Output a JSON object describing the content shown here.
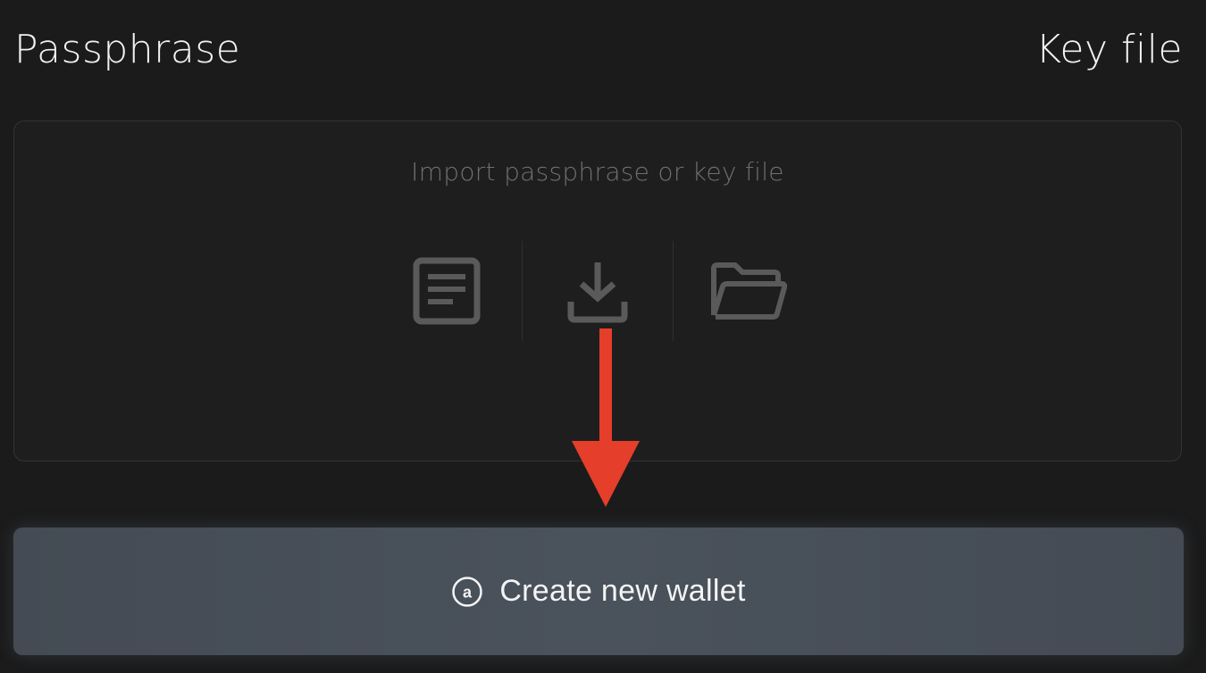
{
  "tabs": {
    "passphrase_label": "Passphrase",
    "keyfile_label": "Key file"
  },
  "dropzone": {
    "title": "Import passphrase or key file",
    "icons": [
      "document-icon",
      "download-icon",
      "folder-icon"
    ]
  },
  "create_button": {
    "label": "Create new wallet",
    "icon": "arweave-logo-icon",
    "icon_letter": "a"
  },
  "colors": {
    "background": "#1b1b1b",
    "icon_muted": "#5a5a5a",
    "arrow": "#e53e2a",
    "button": "#48505a"
  }
}
